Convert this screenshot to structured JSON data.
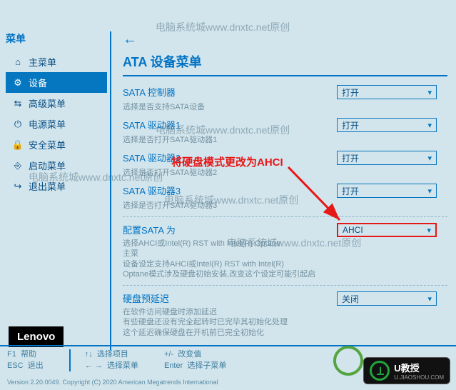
{
  "watermarks": {
    "w1": "电脑系统城www.dnxtc.net原创",
    "w2": "电脑系统城www.dnxtc.net原创",
    "w3": "电脑系统城www.dnxtc.net原创",
    "w4": "电脑系统城www.dnxtc.net原创",
    "w5": "电脑系统城www.dnxtc.net原创"
  },
  "annotation": "将硬盘模式更改为AHCI",
  "sidebar": {
    "title": "菜单",
    "items": [
      {
        "icon": "home-icon",
        "glyph": "⌂",
        "label": "主菜单"
      },
      {
        "icon": "gear-icon",
        "glyph": "⚙",
        "label": "设备"
      },
      {
        "icon": "sliders-icon",
        "glyph": "⇆",
        "label": "高级菜单"
      },
      {
        "icon": "power-icon",
        "glyph": "⏻",
        "label": "电源菜单"
      },
      {
        "icon": "lock-icon",
        "glyph": "🔒",
        "label": "安全菜单"
      },
      {
        "icon": "boot-icon",
        "glyph": "⎆",
        "label": "启动菜单"
      },
      {
        "icon": "exit-icon",
        "glyph": "↪",
        "label": "退出菜单"
      }
    ]
  },
  "main": {
    "back": "←",
    "title": "ATA 设备菜单",
    "settings": [
      {
        "label": "SATA 控制器",
        "desc": "选择是否支持SATA设备",
        "value": "打开"
      },
      {
        "label": "SATA 驱动器1",
        "desc": "选择是否打开SATA驱动器1",
        "value": "打开"
      },
      {
        "label": "SATA 驱动器2",
        "desc": "选择是否打开SATA驱动器2",
        "value": "打开"
      },
      {
        "label": "SATA 驱动器3",
        "desc": "选择是否打开SATA驱动器3",
        "value": "打开"
      }
    ],
    "configure": {
      "label": "配置SATA 为",
      "desc1": "选择AHCI或Intel(R) RST with Intel(R) Optane",
      "desc2": "主菜",
      "desc3": "设备设定支持AHCI或Intel(R) RST with Intel(R)",
      "desc4": "Optane模式涉及硬盘初始安装,改变这个设定可能引起启",
      "value": "AHCI"
    },
    "prefetch": {
      "label": "硬盘预延迟",
      "desc1": "在软件访问硬盘时添加延迟",
      "desc2": "有些硬盘还没有完全起转时已完毕其初始化处理",
      "desc3": "这个延迟确保硬盘在开机前已完全初始化",
      "value": "关闭"
    }
  },
  "brand": "Lenovo",
  "footer": {
    "f1_key": "F1",
    "f1_label": "帮助",
    "esc_key": "ESC",
    "esc_label": "退出",
    "nav_key": "↑↓",
    "nav_label": "选择项目",
    "lr_key": "← →",
    "lr_label": "选择菜单",
    "chg_key": "+/-",
    "chg_label": "改变值",
    "ent_key": "Enter",
    "ent_label": "选择子菜单"
  },
  "version": "Version 2.20.0049. Copyright (C) 2020 American Megatrends International",
  "badge": {
    "text": "U教授",
    "sub": "U.JIAOSHOU.COM"
  }
}
